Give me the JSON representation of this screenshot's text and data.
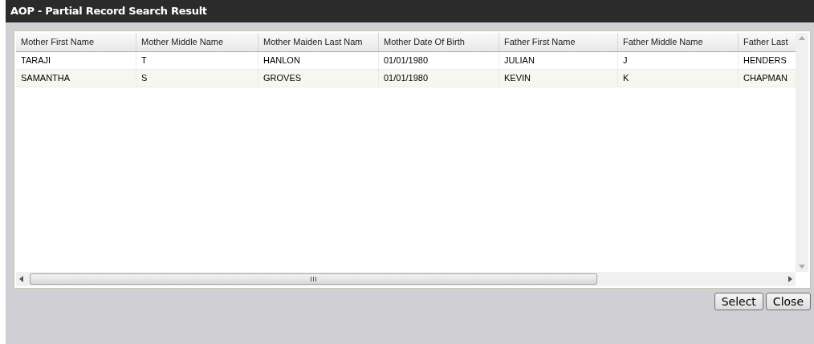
{
  "window": {
    "title": "AOP - Partial Record Search Result"
  },
  "table": {
    "columns": [
      "Mother First Name",
      "Mother Middle Name",
      "Mother Maiden Last Nam",
      "Mother Date Of Birth",
      "Father First Name",
      "Father Middle Name",
      "Father Last"
    ],
    "rows": [
      [
        "TARAJI",
        "T",
        "HANLON",
        "01/01/1980",
        "JULIAN",
        "J",
        "HENDERS"
      ],
      [
        "SAMANTHA",
        "S",
        "GROVES",
        "01/01/1980",
        "KEVIN",
        "K",
        "CHAPMAN"
      ]
    ]
  },
  "buttons": [
    "Select",
    "Close"
  ]
}
